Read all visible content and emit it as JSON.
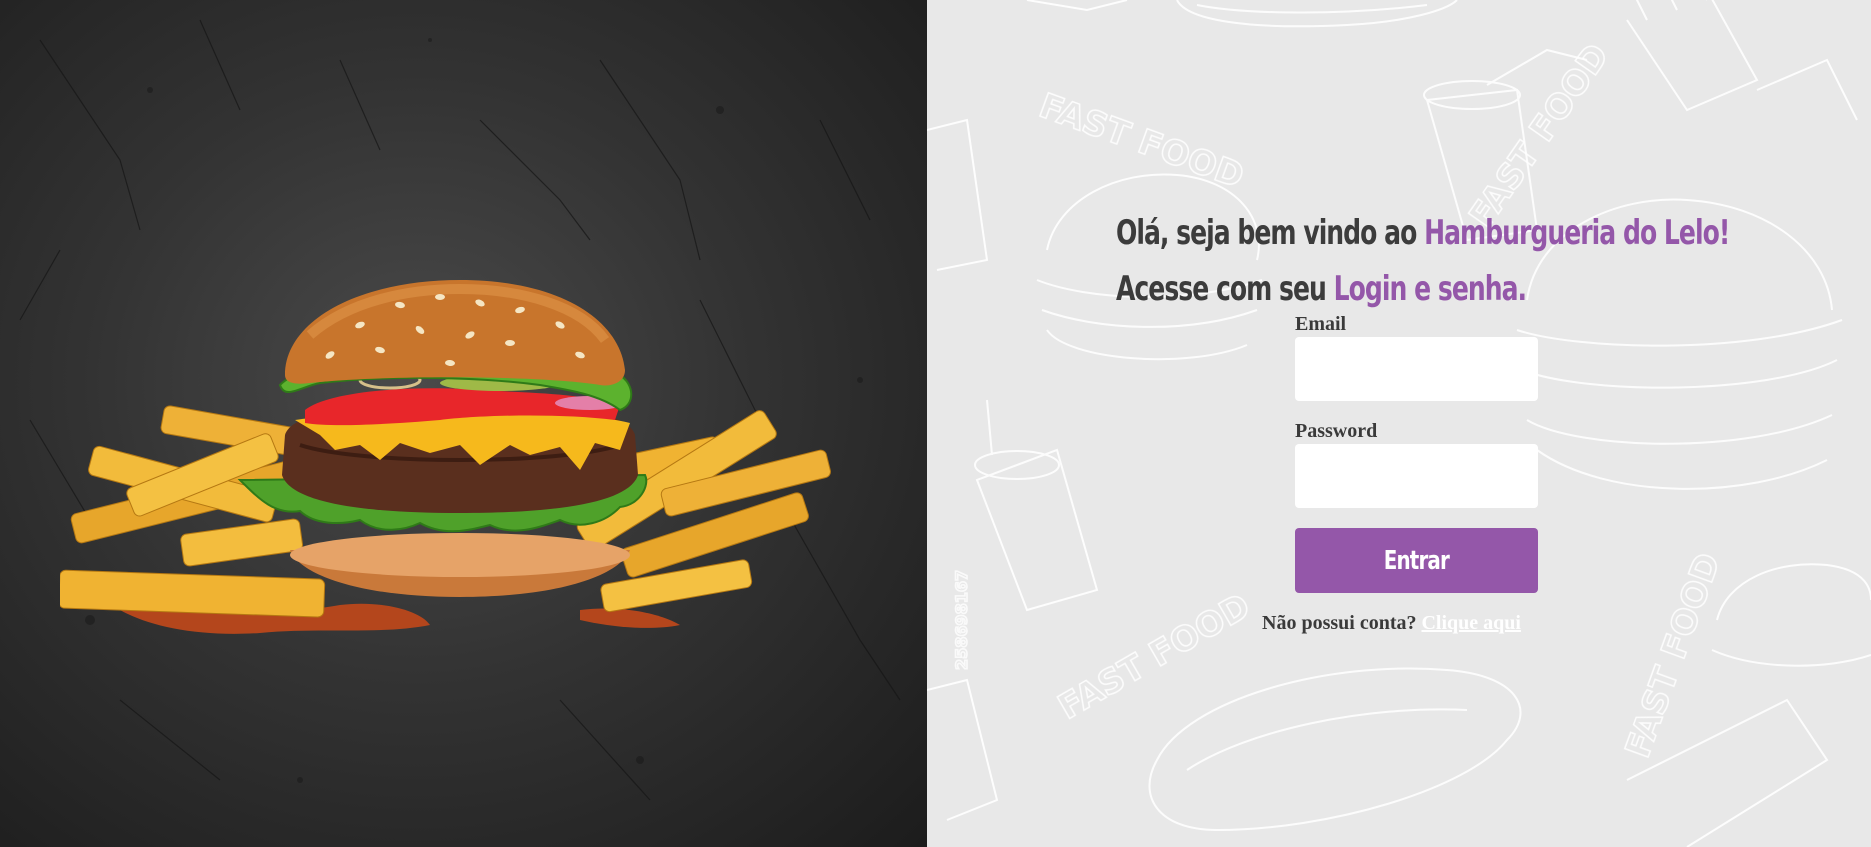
{
  "greeting": {
    "line1_prefix": "Olá, seja bem vindo ao ",
    "line1_brand": "Hamburgueria do Lelo!",
    "line2_prefix": "Acesse com seu ",
    "line2_accent": "Login e senha."
  },
  "form": {
    "email_label": "Email",
    "email_value": "",
    "password_label": "Password",
    "password_value": "",
    "submit_label": "Entrar"
  },
  "signup": {
    "prompt": "Não possui conta?",
    "link_label": "Clique aqui"
  },
  "background": {
    "doodle_text": "FAST FOOD",
    "watermark_number": "258698167"
  },
  "colors": {
    "accent": "#9457a9",
    "text_dark": "#3c3c3c",
    "right_background": "#e8e8e8",
    "left_background": "#2b2b2b"
  }
}
